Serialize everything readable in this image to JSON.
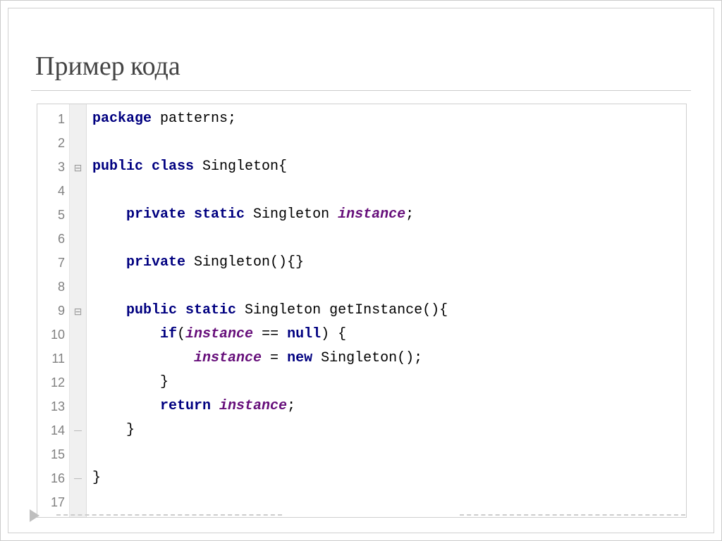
{
  "slide": {
    "title": "Пример кода"
  },
  "editor": {
    "lines": [
      {
        "n": "1",
        "fold": "",
        "ind": 0,
        "t": [
          [
            "kw",
            "package"
          ],
          [
            "plain",
            " patterns;"
          ]
        ]
      },
      {
        "n": "2",
        "fold": "",
        "ind": 0,
        "t": []
      },
      {
        "n": "3",
        "fold": "minus",
        "ind": 0,
        "t": [
          [
            "kw",
            "public class"
          ],
          [
            "plain",
            " Singleton{"
          ]
        ]
      },
      {
        "n": "4",
        "fold": "",
        "ind": 0,
        "t": []
      },
      {
        "n": "5",
        "fold": "",
        "ind": 1,
        "t": [
          [
            "kw",
            "private static"
          ],
          [
            "plain",
            " Singleton "
          ],
          [
            "field",
            "instance"
          ],
          [
            "plain",
            ";"
          ]
        ]
      },
      {
        "n": "6",
        "fold": "",
        "ind": 0,
        "t": []
      },
      {
        "n": "7",
        "fold": "",
        "ind": 1,
        "t": [
          [
            "kw",
            "private"
          ],
          [
            "plain",
            " Singleton(){}"
          ]
        ]
      },
      {
        "n": "8",
        "fold": "",
        "ind": 0,
        "t": []
      },
      {
        "n": "9",
        "fold": "minus",
        "ind": 1,
        "t": [
          [
            "kw",
            "public static"
          ],
          [
            "plain",
            " Singleton getInstance(){"
          ]
        ]
      },
      {
        "n": "10",
        "fold": "",
        "ind": 2,
        "t": [
          [
            "kw",
            "if"
          ],
          [
            "plain",
            "("
          ],
          [
            "field",
            "instance"
          ],
          [
            "plain",
            " == "
          ],
          [
            "kw",
            "null"
          ],
          [
            "plain",
            ") {"
          ]
        ]
      },
      {
        "n": "11",
        "fold": "",
        "ind": 3,
        "t": [
          [
            "field",
            "instance"
          ],
          [
            "plain",
            " = "
          ],
          [
            "kw",
            "new"
          ],
          [
            "plain",
            " Singleton();"
          ]
        ]
      },
      {
        "n": "12",
        "fold": "",
        "ind": 2,
        "t": [
          [
            "plain",
            "}"
          ]
        ]
      },
      {
        "n": "13",
        "fold": "",
        "ind": 2,
        "t": [
          [
            "kw",
            "return"
          ],
          [
            "plain",
            " "
          ],
          [
            "field",
            "instance"
          ],
          [
            "plain",
            ";"
          ]
        ]
      },
      {
        "n": "14",
        "fold": "end",
        "ind": 1,
        "t": [
          [
            "plain",
            "}"
          ]
        ]
      },
      {
        "n": "15",
        "fold": "",
        "ind": 0,
        "t": []
      },
      {
        "n": "16",
        "fold": "end",
        "ind": 0,
        "t": [
          [
            "plain",
            "}"
          ]
        ]
      },
      {
        "n": "17",
        "fold": "",
        "ind": 0,
        "t": []
      }
    ]
  }
}
